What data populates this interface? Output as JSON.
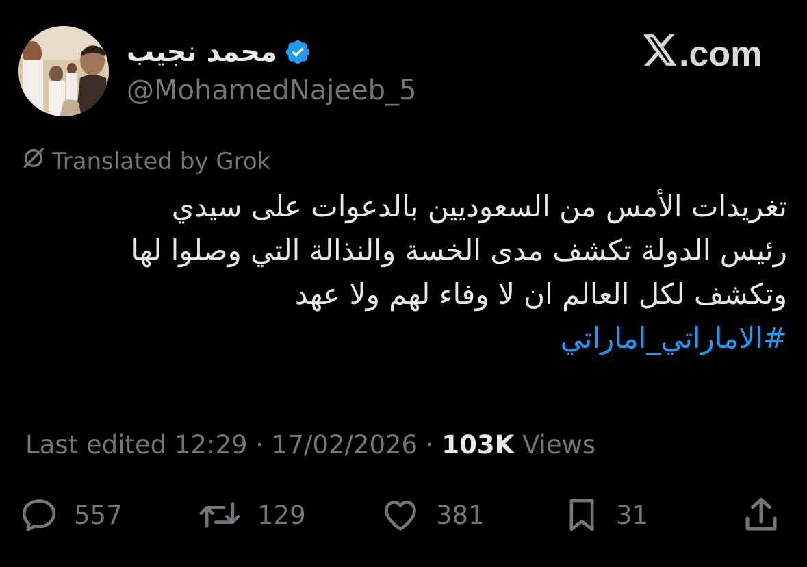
{
  "author": {
    "display_name": "محمد نجيب",
    "handle": "@MohamedNajeeb_5",
    "verified": true,
    "avatar": "profile-photo"
  },
  "brand": {
    "label": ".com",
    "logo_icon": "x-logo-icon"
  },
  "translation": {
    "label": "Translated by Grok",
    "icon": "grok-icon"
  },
  "tweet": {
    "lines": [
      "تغريدات الأمس من السعوديين بالدعوات  على سيدي",
      "رئيس الدولة تكشف مدى الخسة والنذالة التي وصلوا لها",
      "وتكشف لكل العالم ان لا وفاء لهم ولا عهد"
    ],
    "hashtag": "#الاماراتي_اماراتي"
  },
  "meta": {
    "edited_prefix": "Last edited",
    "time": "12:29",
    "sep": "·",
    "date": "17/02/2026",
    "views_count": "103K",
    "views_label": "Views"
  },
  "actions": {
    "reply": {
      "icon": "reply-icon",
      "count": "557"
    },
    "retweet": {
      "icon": "retweet-icon",
      "count": "129"
    },
    "like": {
      "icon": "heart-icon",
      "count": "381"
    },
    "bookmark": {
      "icon": "bookmark-icon",
      "count": "31"
    },
    "share": {
      "icon": "share-icon"
    }
  },
  "colors": {
    "background": "#000000",
    "text_primary": "#e7e9ea",
    "text_secondary": "#71767b",
    "accent": "#1d9bf0"
  }
}
